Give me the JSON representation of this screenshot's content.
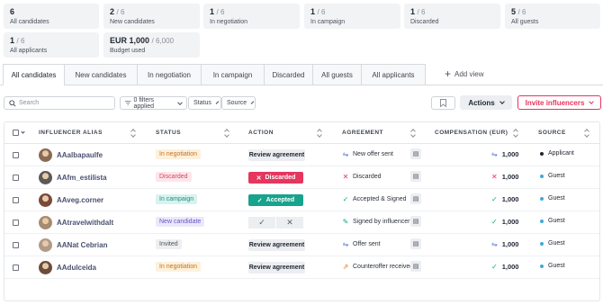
{
  "stats": [
    {
      "count": "6",
      "denominator": "",
      "label": "All candidates"
    },
    {
      "count": "2",
      "denominator": "/ 6",
      "label": "New candidates"
    },
    {
      "count": "1",
      "denominator": "/ 6",
      "label": "In negotiation"
    },
    {
      "count": "1",
      "denominator": "/ 6",
      "label": "In campaign"
    },
    {
      "count": "1",
      "denominator": "/ 6",
      "label": "Discarded"
    },
    {
      "count": "5",
      "denominator": "/ 6",
      "label": "All guests"
    },
    {
      "count": "1",
      "denominator": "/ 6",
      "label": "All applicants"
    },
    {
      "count": "EUR 1,000",
      "denominator": "/ 6,000",
      "label": "Budget used"
    }
  ],
  "tabs": [
    "All candidates",
    "New candidates",
    "In negotiation",
    "In campaign",
    "Discarded",
    "All guests",
    "All applicants"
  ],
  "add_view": "Add view",
  "toolbar": {
    "search_placeholder": "Search",
    "filters": "0 filters applied",
    "status": "Status",
    "source": "Source",
    "actions": "Actions",
    "invite": "Invite influencers"
  },
  "columns": {
    "alias": "INFLUENCER ALIAS",
    "status": "STATUS",
    "action": "ACTION",
    "agreement": "AGREEMENT",
    "compensation": "COMPENSATION (EUR)",
    "source": "SOURCE"
  },
  "rows": [
    {
      "alias": "AAalbapaulfe",
      "status": "In negotiation",
      "status_kind": "neg",
      "action": "Review agreement",
      "action_kind": "review",
      "agreement": "New offer sent",
      "agreement_icon": "offer-sent-icon",
      "compensation": "1,000",
      "comp_icon": "offer-sent-icon",
      "source": "Applicant",
      "source_color": "#1f2530",
      "avatar_color": "#8b6a55"
    },
    {
      "alias": "AAfm_estilista",
      "status": "Discarded",
      "status_kind": "dis",
      "action": "Discarded",
      "action_kind": "disc",
      "agreement": "Discarded",
      "agreement_icon": "x-icon",
      "compensation": "1,000",
      "comp_icon": "x-icon",
      "source": "Guest",
      "source_color": "#3fa9d8",
      "avatar_color": "#5a5a5a"
    },
    {
      "alias": "AAveg.corner",
      "status": "In campaign",
      "status_kind": "cam",
      "action": "Accepted",
      "action_kind": "acc",
      "agreement": "Accepted & Signed",
      "agreement_icon": "check-icon",
      "compensation": "1,000",
      "comp_icon": "check-icon",
      "source": "Guest",
      "source_color": "#3fa9d8",
      "avatar_color": "#7a4a3a"
    },
    {
      "alias": "AAtravelwithdalt",
      "status": "New candidate",
      "status_kind": "new",
      "action": "",
      "action_kind": "pair",
      "agreement": "Signed by influencer",
      "agreement_icon": "signed-icon",
      "compensation": "1,000",
      "comp_icon": "check-icon",
      "source": "Guest",
      "source_color": "#3fa9d8",
      "avatar_color": "#a58c70"
    },
    {
      "alias": "AANat Cebrian",
      "status": "Invited",
      "status_kind": "inv",
      "action": "Review agreement",
      "action_kind": "review",
      "agreement": "Offer sent",
      "agreement_icon": "offer-sent-icon",
      "compensation": "1,000",
      "comp_icon": "offer-sent-icon",
      "source": "Guest",
      "source_color": "#3fa9d8",
      "avatar_color": "#b09a88"
    },
    {
      "alias": "AAdulceida",
      "status": "In negotiation",
      "status_kind": "neg",
      "action": "Review agreement",
      "action_kind": "review",
      "agreement": "Counteroffer received",
      "agreement_icon": "counteroffer-icon",
      "compensation": "1,000",
      "comp_icon": "check-icon",
      "source": "Guest",
      "source_color": "#3fa9d8",
      "avatar_color": "#6b4d3c"
    }
  ]
}
